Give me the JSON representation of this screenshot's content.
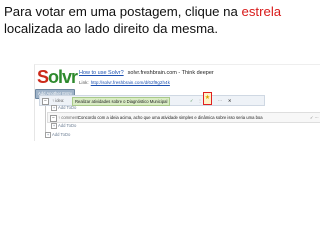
{
  "caption": {
    "line1_prefix": "Para votar em uma postagem, clique na ",
    "line1_highlight": "estrela",
    "line2": "localizada ao lado direito da mesma."
  },
  "colors": {
    "highlight": "#d81b1b",
    "logo_s": "#cc2a1a",
    "logo_rest": "#2e8a2e",
    "link": "#1a4fb0"
  },
  "app": {
    "logo_s": "S",
    "logo_rest": "olvr",
    "add_button": "Add Another Entry",
    "howto_link": "How to use Solvr?",
    "site_title": "solvr.freshbrain.com - Think deeper",
    "link_label": "Link:",
    "link_url": "http://solvr.freshbrain.com/d/62f9g2h4k"
  },
  "idea": {
    "collapse": "−",
    "tag": "↑ idea:",
    "text": "Realizar atividades sobre o Diagnóstico Municipal",
    "vote_icon": "star-icon",
    "tool_a": "✓",
    "tool_b": "⋮",
    "tool_c": "⋯",
    "close": "✕"
  },
  "comment": {
    "collapse": "−",
    "tag": "↑ comment:",
    "text": "Concordo com a ideia acima, acho que uma atividade simples e dinâmica sobre isso seria uma boa",
    "icons": "✓ ⋯"
  },
  "todo": {
    "add_label": "Add ToDo"
  }
}
